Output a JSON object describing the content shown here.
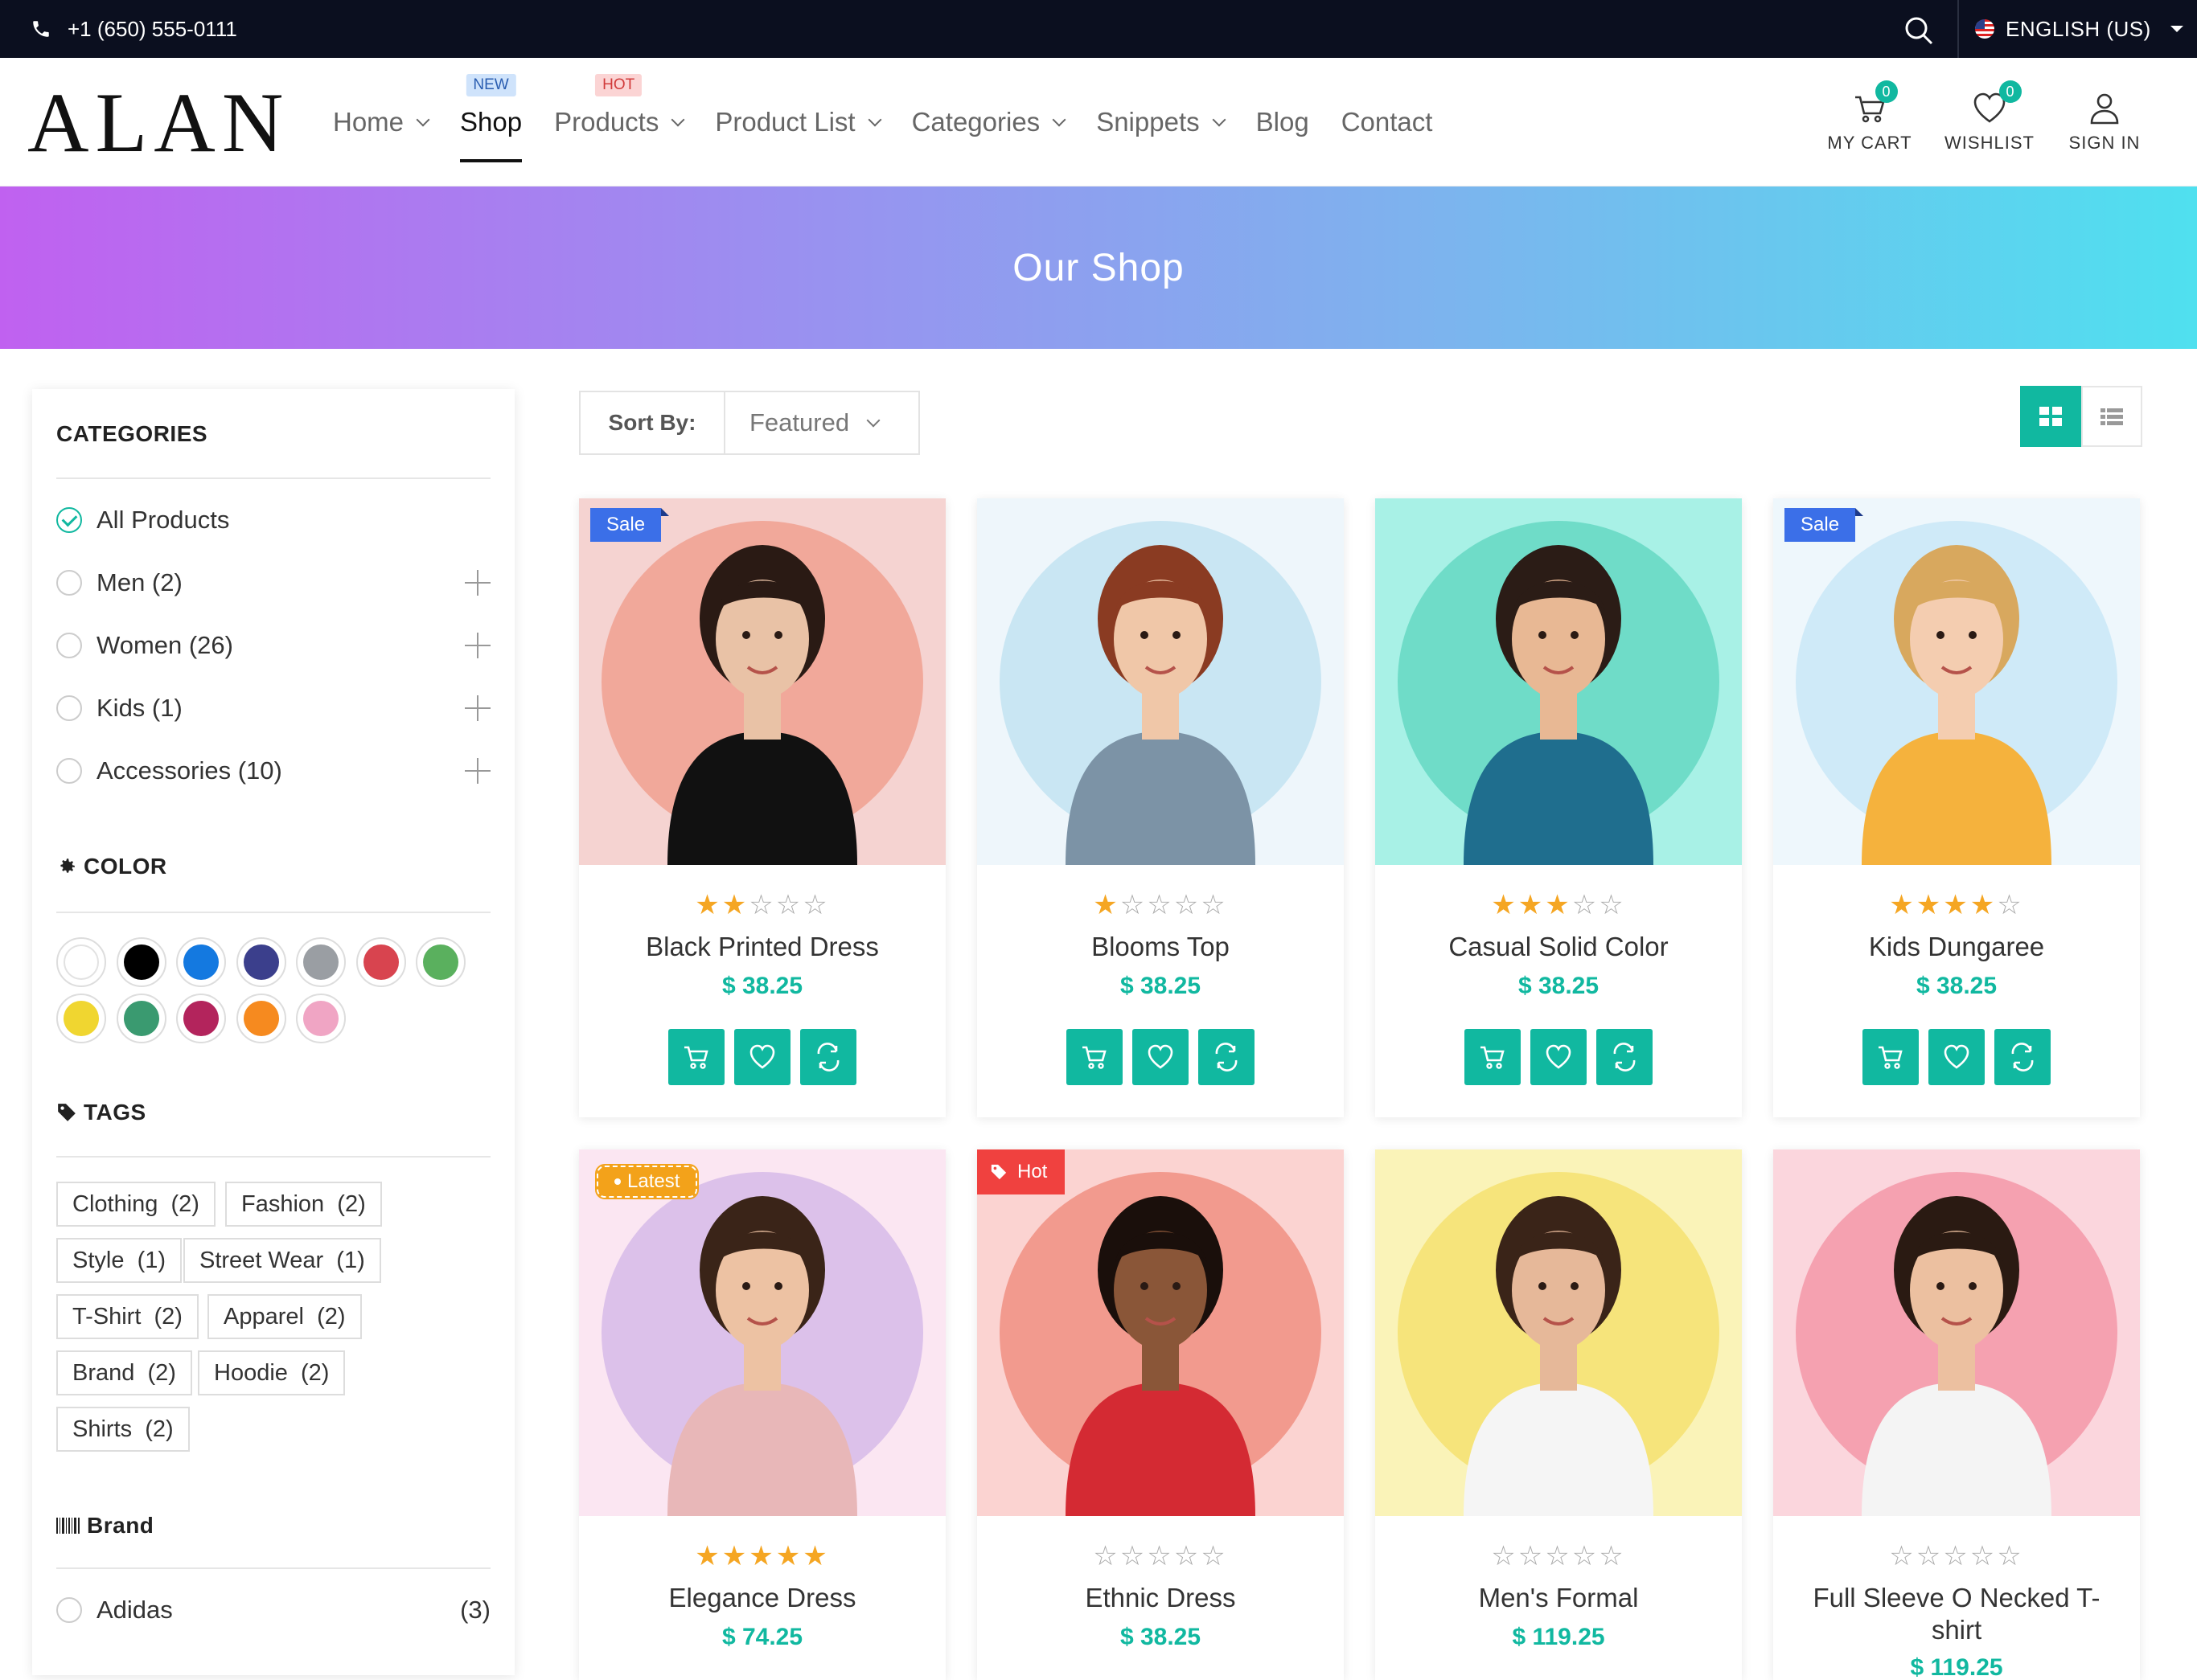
{
  "topbar": {
    "phone": "+1 (650) 555-0111",
    "language": "ENGLISH (US)",
    "icons": [
      "phone-icon",
      "search-icon",
      "flag-us-icon",
      "caret-down-icon"
    ]
  },
  "header": {
    "logo": "ALAN",
    "nav": [
      {
        "label": "Home",
        "dropdown": true,
        "badge": ""
      },
      {
        "label": "Shop",
        "dropdown": false,
        "badge": "NEW",
        "active": true
      },
      {
        "label": "Products",
        "dropdown": true,
        "badge": "HOT"
      },
      {
        "label": "Product List",
        "dropdown": true,
        "badge": ""
      },
      {
        "label": "Categories",
        "dropdown": true,
        "badge": ""
      },
      {
        "label": "Snippets",
        "dropdown": true,
        "badge": ""
      },
      {
        "label": "Blog",
        "dropdown": false,
        "badge": ""
      },
      {
        "label": "Contact",
        "dropdown": false,
        "badge": ""
      }
    ],
    "cart_label": "MY CART",
    "cart_count": "0",
    "wishlist_label": "WISHLIST",
    "wishlist_count": "0",
    "signin_label": "SIGN IN"
  },
  "banner": {
    "title": "Our Shop"
  },
  "sidebar": {
    "categories_title": "CATEGORIES",
    "categories": [
      {
        "label": "All Products",
        "checked": true,
        "expandable": false
      },
      {
        "label": "Men (2)",
        "checked": false,
        "expandable": true
      },
      {
        "label": "Women (26)",
        "checked": false,
        "expandable": true
      },
      {
        "label": "Kids (1)",
        "checked": false,
        "expandable": true
      },
      {
        "label": "Accessories (10)",
        "checked": false,
        "expandable": true
      }
    ],
    "color_title": "COLOR",
    "colors": [
      "#ffffff",
      "#000000",
      "#1479e0",
      "#3b3f8c",
      "#9a9ea3",
      "#d8444f",
      "#5ab05e",
      "#f0d630",
      "#3a9a70",
      "#b3245c",
      "#f68a1f",
      "#f0a5c4"
    ],
    "tags_title": "TAGS",
    "tags": [
      "Clothing  (2)",
      "Fashion  (2)",
      "Style  (1)",
      "Street Wear  (1)",
      "T-Shirt  (2)",
      "Apparel  (2)",
      "Brand  (2)",
      "Hoodie  (2)",
      "Shirts  (2)"
    ],
    "brand_title": "Brand",
    "brands": [
      {
        "label": "Adidas",
        "count": "(3)"
      }
    ]
  },
  "toolbar": {
    "sort_label": "Sort By:",
    "sort_value": "Featured"
  },
  "products": [
    {
      "name": "Black Printed Dress",
      "price": "$ 38.25",
      "rating": 2,
      "ribbon": "Sale",
      "bg": "#f5d3d1",
      "circle": "#f1a89a",
      "skin": "#e9c2a6",
      "top": "#111111",
      "hair": "#2a1a14"
    },
    {
      "name": "Blooms Top",
      "price": "$ 38.25",
      "rating": 1,
      "ribbon": "",
      "bg": "#eef6fb",
      "circle": "#c9e6f3",
      "skin": "#f0c7a8",
      "top": "#7c93a6",
      "hair": "#8a3b22"
    },
    {
      "name": "Casual Solid Color",
      "price": "$ 38.25",
      "rating": 3,
      "ribbon": "",
      "bg": "#a8f1e6",
      "circle": "#6fdcc8",
      "skin": "#e8b894",
      "top": "#1f6e8e",
      "hair": "#2b1c16"
    },
    {
      "name": "Kids Dungaree",
      "price": "$ 38.25",
      "rating": 4,
      "ribbon": "Sale",
      "bg": "#eef7fc",
      "circle": "#cfeaf8",
      "skin": "#f4cdb0",
      "top": "#f5b23d",
      "hair": "#d8a85e"
    },
    {
      "name": "Elegance Dress",
      "price": "$ 74.25",
      "rating": 5,
      "ribbon": "Latest",
      "bg": "#fbe6f2",
      "circle": "#dcc1ea",
      "skin": "#edc2a3",
      "top": "#e8b7b8",
      "hair": "#3a2418"
    },
    {
      "name": "Ethnic Dress",
      "price": "$ 38.25",
      "rating": 0,
      "ribbon": "Hot",
      "bg": "#fbd3d1",
      "circle": "#f29a8e",
      "skin": "#8a5638",
      "top": "#d42a33",
      "hair": "#1a0f0b"
    },
    {
      "name": "Men's Formal",
      "price": "$ 119.25",
      "rating": 0,
      "ribbon": "",
      "bg": "#faf3b8",
      "circle": "#f6e47b",
      "skin": "#e6b899",
      "top": "#f5f5f5",
      "hair": "#3a2418"
    },
    {
      "name": "Full Sleeve O Necked T-shirt",
      "price": "$ 119.25",
      "rating": 0,
      "ribbon": "",
      "bg": "#fbd6dd",
      "circle": "#f5a1b0",
      "skin": "#ecc0a0",
      "top": "#f4f4f4",
      "hair": "#2a1a12"
    }
  ],
  "accent": "#11b8a0"
}
